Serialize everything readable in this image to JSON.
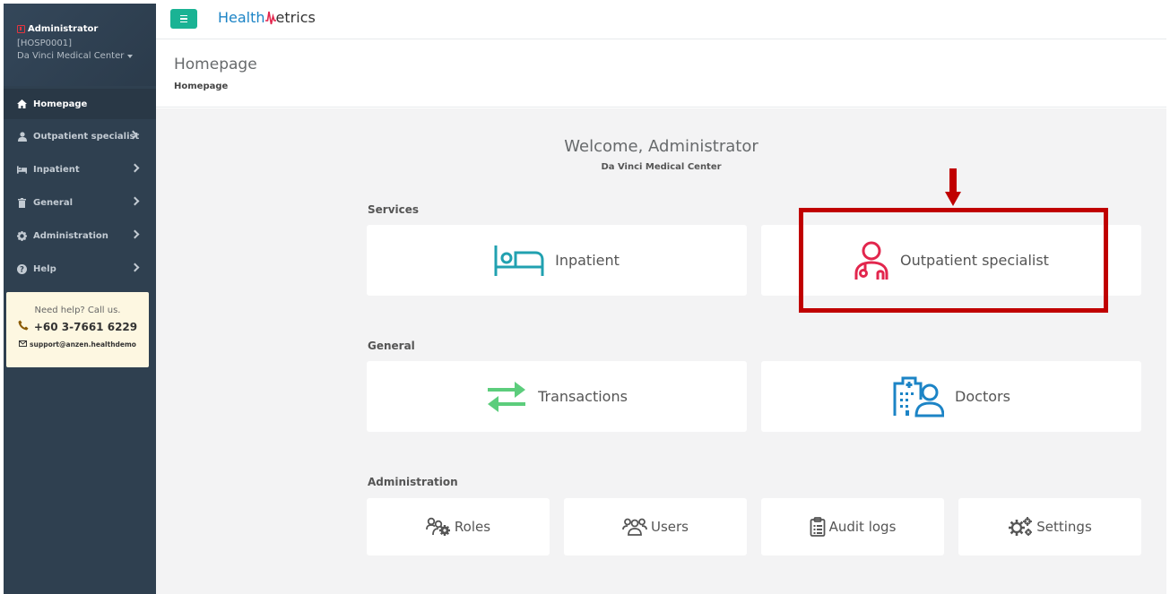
{
  "sidebar": {
    "profile": {
      "name": "Administrator",
      "code": "[HOSP0001]",
      "org": "Da Vinci Medical Center"
    },
    "items": [
      {
        "label": "Homepage",
        "icon": "home-icon",
        "active": true
      },
      {
        "label": "Outpatient specialist",
        "icon": "user-md-icon"
      },
      {
        "label": "Inpatient",
        "icon": "bed-icon"
      },
      {
        "label": "General",
        "icon": "trash-icon"
      },
      {
        "label": "Administration",
        "icon": "cog-icon"
      },
      {
        "label": "Help",
        "icon": "question-icon"
      }
    ],
    "help": {
      "title": "Need help? Call us.",
      "phone": "+60 3-7661 6229",
      "email": "support@anzen.healthdemo"
    }
  },
  "topbar": {
    "logo_prefix": "Health",
    "logo_suffix": "etrics"
  },
  "header": {
    "title": "Homepage",
    "breadcrumb": "Homepage"
  },
  "main": {
    "welcome": "Welcome, Administrator",
    "org": "Da Vinci Medical Center",
    "sections": {
      "services": {
        "title": "Services",
        "cards": [
          {
            "label": "Inpatient",
            "icon": "bed-icon",
            "color": "#21a1b0"
          },
          {
            "label": "Outpatient specialist",
            "icon": "doctor-icon",
            "color": "#e2264d"
          }
        ]
      },
      "general": {
        "title": "General",
        "cards": [
          {
            "label": "Transactions",
            "icon": "transfer-icon",
            "color": "#5ccd7c"
          },
          {
            "label": "Doctors",
            "icon": "hospital-user-icon",
            "color": "#1c84c6"
          }
        ]
      },
      "administration": {
        "title": "Administration",
        "cards": [
          {
            "label": "Roles",
            "icon": "roles-icon"
          },
          {
            "label": "Users",
            "icon": "users-icon"
          },
          {
            "label": "Audit logs",
            "icon": "clipboard-icon"
          },
          {
            "label": "Settings",
            "icon": "settings-icon"
          }
        ]
      }
    }
  },
  "colors": {
    "sidebar_bg": "#2f4050",
    "accent": "#1ab394",
    "highlight": "#c00000"
  }
}
